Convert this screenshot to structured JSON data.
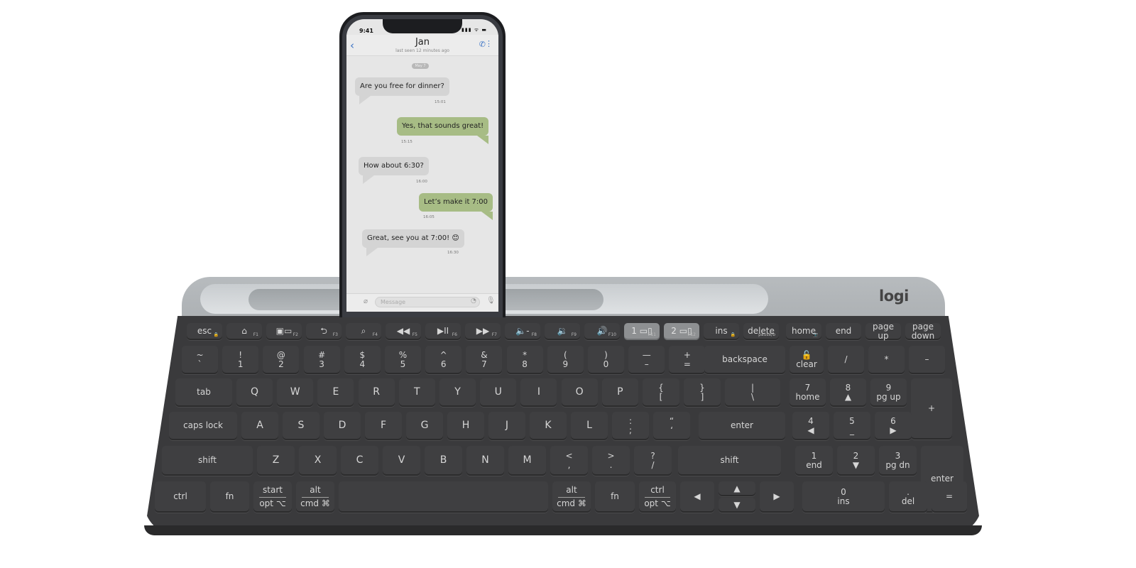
{
  "brand": {
    "logo": "logi"
  },
  "phone": {
    "status_time": "9:41",
    "status_icons": "▮▮▮ ᯤ ▬",
    "chat": {
      "contact_name": "Jan",
      "last_seen": "last seen 12 minutes ago",
      "date_label": "May 7",
      "messages": [
        {
          "direction": "in",
          "text": "Are you free for dinner?",
          "time": "15:01"
        },
        {
          "direction": "out",
          "text": "Yes, that sounds great!",
          "time": "15:15"
        },
        {
          "direction": "in",
          "text": "How about 6:30?",
          "time": "16:00"
        },
        {
          "direction": "out",
          "text": "Let’s make it 7:00",
          "time": "16:05"
        },
        {
          "direction": "in",
          "text": "Great, see you at 7:00! 😊",
          "time": "16:30"
        }
      ],
      "input_placeholder": "Message"
    },
    "icons": {
      "back": "‹",
      "call": "✆",
      "menu": "⋮",
      "clip": "⌀",
      "sticker": "◔",
      "mic": "🎙"
    }
  },
  "keyboard": {
    "fn_row": [
      {
        "label": "esc",
        "fn": "🔒"
      },
      {
        "label": "⌂",
        "fn": "F1"
      },
      {
        "label": "▣▭",
        "fn": "F2"
      },
      {
        "label": "⮌",
        "fn": "F3"
      },
      {
        "label": "⌕",
        "fn": "F4"
      },
      {
        "label": "◀◀",
        "fn": "F5"
      },
      {
        "label": "▶II",
        "fn": "F6"
      },
      {
        "label": "▶▶",
        "fn": "F7"
      },
      {
        "label": "🔈-",
        "fn": "F8"
      },
      {
        "label": "🔉",
        "fn": "F9"
      },
      {
        "label": "🔊",
        "fn": "F10"
      },
      {
        "label": "1 ▭▯",
        "fn": "F11"
      },
      {
        "label": "2 ▭▯",
        "fn": "F12"
      },
      {
        "label": "ins",
        "fn": "🔒"
      },
      {
        "label": "delete",
        "fn": "pause/b"
      },
      {
        "label": "home",
        "fn": "📷"
      },
      {
        "label": "end",
        "fn": ""
      },
      {
        "label": "page up",
        "fn": ""
      },
      {
        "label": "page down",
        "fn": ""
      }
    ],
    "num_row": [
      [
        "~",
        "`"
      ],
      [
        "!",
        "1"
      ],
      [
        "@",
        "2"
      ],
      [
        "#",
        "3"
      ],
      [
        "$",
        "4"
      ],
      [
        "%",
        "5"
      ],
      [
        "^",
        "6"
      ],
      [
        "&",
        "7"
      ],
      [
        "*",
        "8"
      ],
      [
        "(",
        "9"
      ],
      [
        ")",
        "0"
      ],
      [
        "—",
        "–"
      ],
      [
        "+",
        "="
      ]
    ],
    "backspace": "backspace",
    "clear": {
      "top": "🔓",
      "bottom": "clear"
    },
    "numpad_top": [
      "/",
      "*",
      "–"
    ],
    "tab": "tab",
    "qwerty": [
      "Q",
      "W",
      "E",
      "R",
      "T",
      "Y",
      "U",
      "I",
      "O",
      "P"
    ],
    "brackets": [
      [
        "{",
        "["
      ],
      [
        "}",
        "]"
      ],
      [
        "|",
        "\\"
      ]
    ],
    "numpad_row2": [
      [
        "7",
        "home"
      ],
      [
        "8",
        "▲"
      ],
      [
        "9",
        "pg up"
      ]
    ],
    "plus": "+",
    "caps": "caps lock",
    "asdf": [
      "A",
      "S",
      "D",
      "F",
      "G",
      "H",
      "J",
      "K",
      "L"
    ],
    "semi": [
      [
        ":",
        ";"
      ],
      [
        "“",
        "‘"
      ]
    ],
    "enter": "enter",
    "numpad_row3": [
      [
        "4",
        "◀"
      ],
      [
        "5",
        "_"
      ],
      [
        "6",
        "▶"
      ]
    ],
    "shift": "shift",
    "zxcv": [
      "Z",
      "X",
      "C",
      "V",
      "B",
      "N",
      "M"
    ],
    "punct": [
      [
        "<",
        ","
      ],
      [
        ">",
        "."
      ],
      [
        "?",
        "/"
      ]
    ],
    "numpad_row4": [
      [
        "1",
        "end"
      ],
      [
        "2",
        "▼"
      ],
      [
        "3",
        "pg dn"
      ]
    ],
    "numpad_enter": "enter",
    "bottom": {
      "ctrl": "ctrl",
      "fn": "fn",
      "start": [
        "start",
        "opt ⌥"
      ],
      "alt": [
        "alt",
        "cmd ⌘"
      ],
      "alt_r": [
        "alt",
        "cmd ⌘"
      ],
      "fn_r": "fn",
      "ctrl_r": [
        "ctrl",
        "opt ⌥"
      ],
      "left": "◀",
      "up": "▲",
      "down": "▼",
      "right": "▶",
      "zero": [
        "0",
        "ins"
      ],
      "del": [
        ".",
        "del"
      ],
      "equals": "="
    }
  }
}
